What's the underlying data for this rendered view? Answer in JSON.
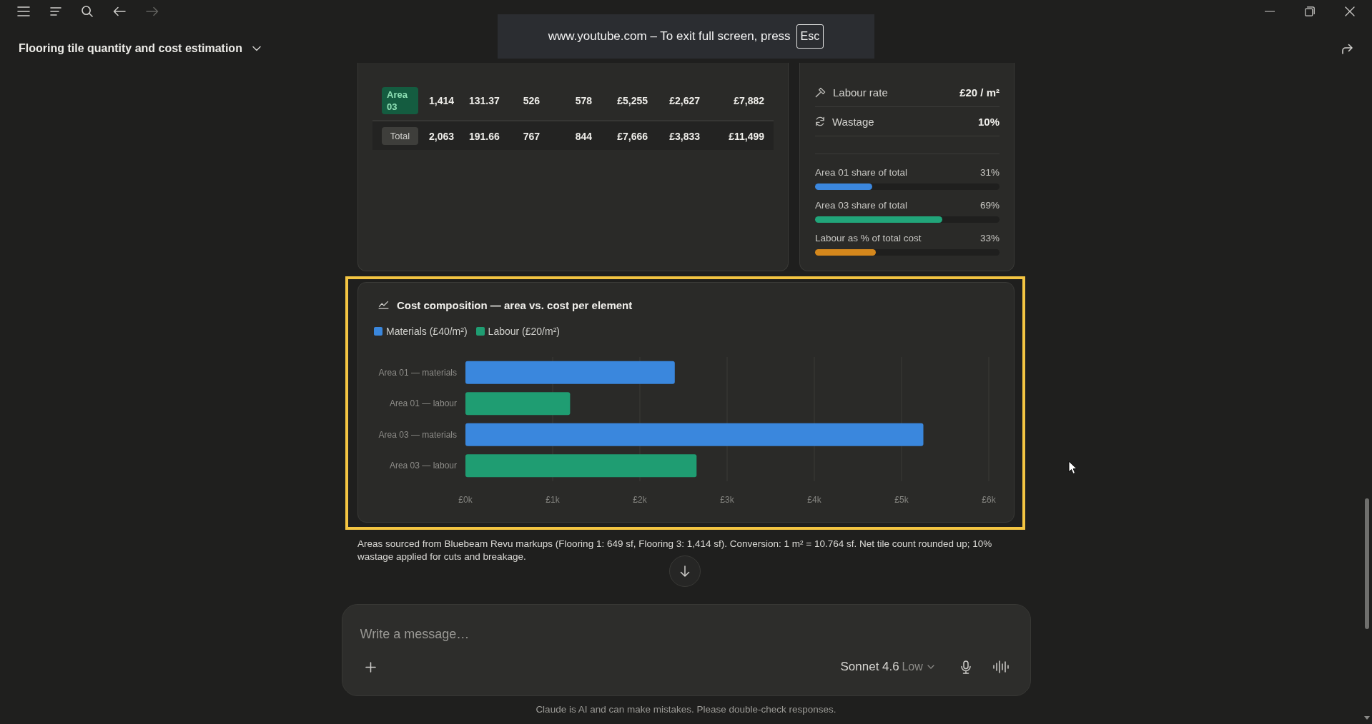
{
  "window": {
    "title": "Flooring tile quantity and cost estimation"
  },
  "fullscreen_notice": {
    "text": "www.youtube.com – To exit full screen, press",
    "key": "Esc"
  },
  "table": {
    "rows": [
      {
        "kind": "area",
        "label": "Area 03",
        "cells": [
          "1,414",
          "131.37",
          "526",
          "578",
          "£5,255",
          "£2,627",
          "£7,882"
        ]
      },
      {
        "kind": "total",
        "label": "Total",
        "cells": [
          "2,063",
          "191.66",
          "767",
          "844",
          "£7,666",
          "£3,833",
          "£11,499"
        ]
      }
    ]
  },
  "rates": [
    {
      "kind": "labour",
      "label": "Labour rate",
      "value": "£20 / m²"
    },
    {
      "kind": "wastage",
      "label": "Wastage",
      "value": "10%"
    }
  ],
  "shares": [
    {
      "label": "Area 01 share of total",
      "reading": "31%",
      "level": 0.31,
      "color": "#3b87de"
    },
    {
      "label": "Area 03 share of total",
      "reading": "69%",
      "level": 0.69,
      "color": "#21a57a"
    },
    {
      "label": "Labour as % of total cost",
      "reading": "33%",
      "level": 0.33,
      "color": "#d4871c"
    }
  ],
  "cost_chart": {
    "highlighted": true,
    "chart_data": {
      "type": "bar",
      "orientation": "horizontal",
      "grid": true,
      "title": "Cost composition — area vs. cost per element",
      "categories": [
        "Area 01 — materials",
        "Area 01 — labour",
        "Area 03 — materials",
        "Area 03 — labour"
      ],
      "series": [
        {
          "name": "Materials (£40/m²)",
          "color": "#3a87dd",
          "values": [
            2400,
            null,
            5250,
            null
          ]
        },
        {
          "name": "Labour (£20/m²)",
          "color": "#1f9d72",
          "values": [
            null,
            1200,
            null,
            2650
          ]
        }
      ],
      "xlim": [
        0,
        6000
      ],
      "xticks": [
        {
          "value": 0,
          "label": "£0k"
        },
        {
          "value": 1000,
          "label": "£1k"
        },
        {
          "value": 2000,
          "label": "£2k"
        },
        {
          "value": 3000,
          "label": "£3k"
        },
        {
          "value": 4000,
          "label": "£4k"
        },
        {
          "value": 5000,
          "label": "£5k"
        },
        {
          "value": 6000,
          "label": "£6k"
        }
      ]
    }
  },
  "note": "Areas sourced from Bluebeam Revu markups (Flooring 1: 649 sf, Flooring 3: 1,414 sf). Conversion: 1 m² = 10.764 sf. Net tile count rounded up; 10% wastage applied for cuts and breakage.",
  "composer": {
    "placeholder": "Write a message…",
    "model": "Sonnet 4.6",
    "effort": "Low"
  },
  "disclaimer": "Claude is AI and can make mistakes. Please double-check responses."
}
